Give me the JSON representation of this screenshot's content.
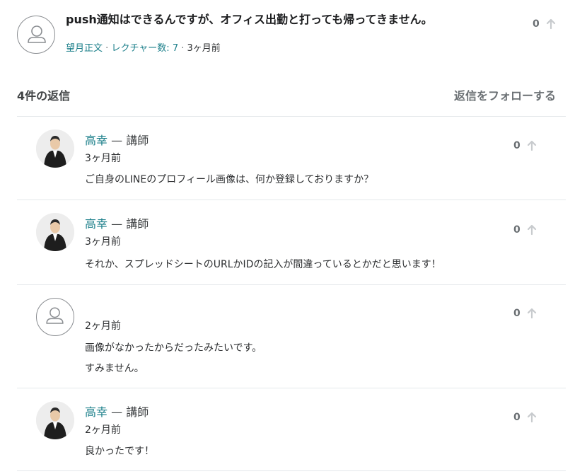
{
  "question": {
    "title": "push通知はできるんですが、オフィス出勤と打っても帰ってきません。",
    "author": "望月正文",
    "lectures": "レクチャー数: 7",
    "time": "3ヶ月前",
    "sep1": "·",
    "sep2": "·",
    "votes": "0",
    "avatar_icon": "user-placeholder-icon"
  },
  "replies_header": {
    "count_label": "4件の返信",
    "follow_label": "返信をフォローする"
  },
  "replies": [
    {
      "name": "高幸",
      "role": "— 講師",
      "time": "3ヶ月前",
      "body": [
        "ご自身のLINEのプロフィール画像は、何か登録しておりますか？"
      ],
      "votes": "0",
      "avatar": "instructor-photo"
    },
    {
      "name": "高幸",
      "role": "— 講師",
      "time": "3ヶ月前",
      "body": [
        "それか、スプレッドシートのURLかIDの記入が間違っているとかだと思います！"
      ],
      "votes": "0",
      "avatar": "instructor-photo"
    },
    {
      "name": "",
      "role": "",
      "time": "2ヶ月前",
      "body": [
        "画像がなかったからだったみたいです。",
        "すみません。"
      ],
      "votes": "0",
      "avatar": "user-placeholder-icon"
    },
    {
      "name": "高幸",
      "role": "— 講師",
      "time": "2ヶ月前",
      "body": [
        "良かったです！"
      ],
      "votes": "0",
      "avatar": "instructor-photo"
    }
  ],
  "colors": {
    "link": "#1b7f8a",
    "text": "#2d2f31",
    "muted": "#6a6f73",
    "divider": "#e4e8eb"
  }
}
